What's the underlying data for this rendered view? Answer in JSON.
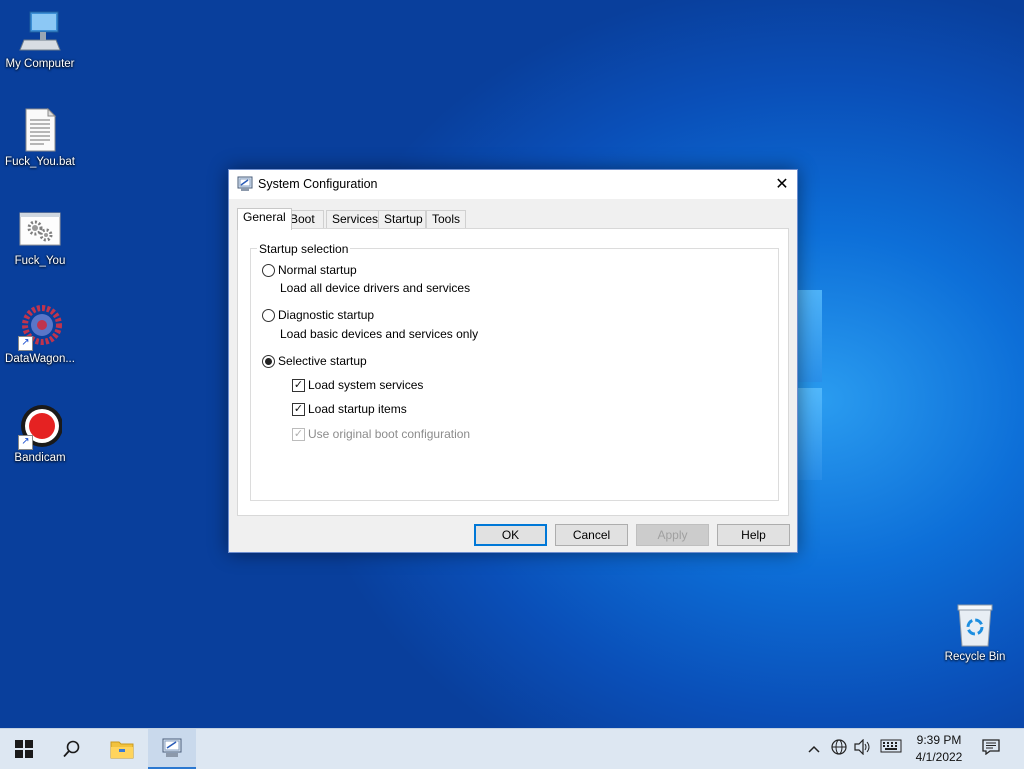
{
  "desktop": {
    "icons": [
      {
        "label": "My Computer",
        "icon": "computer-icon"
      },
      {
        "label": "Fuck_You.bat",
        "icon": "batch-file-icon"
      },
      {
        "label": "Fuck_You",
        "icon": "settings-file-icon"
      },
      {
        "label": "DataWagon...",
        "icon": "gear-shortcut-icon"
      },
      {
        "label": "Bandicam",
        "icon": "bandicam-icon"
      },
      {
        "label": "Recycle Bin",
        "icon": "recycle-bin-icon"
      }
    ]
  },
  "dialog": {
    "title": "System Configuration",
    "close_glyph": "✕",
    "tabs": [
      "General",
      "Boot",
      "Services",
      "Startup",
      "Tools"
    ],
    "active_tab": "General",
    "group_label": "Startup selection",
    "options": {
      "normal": {
        "label": "Normal startup",
        "desc": "Load all device drivers and services",
        "selected": false
      },
      "diagnostic": {
        "label": "Diagnostic startup",
        "desc": "Load basic devices and services only",
        "selected": false
      },
      "selective": {
        "label": "Selective startup",
        "selected": true
      }
    },
    "checkboxes": {
      "system_services": {
        "label": "Load system services",
        "checked": true
      },
      "startup_items": {
        "label": "Load startup items",
        "checked": true
      },
      "boot_config": {
        "label": "Use original boot configuration",
        "checked": true,
        "disabled": true
      }
    },
    "buttons": {
      "ok": "OK",
      "cancel": "Cancel",
      "apply": "Apply",
      "help": "Help"
    }
  },
  "taskbar": {
    "time": "9:39 PM",
    "date": "4/1/2022",
    "tray": [
      "chevron-up-icon",
      "network-icon",
      "volume-icon",
      "keyboard-icon",
      "notification-icon"
    ]
  }
}
